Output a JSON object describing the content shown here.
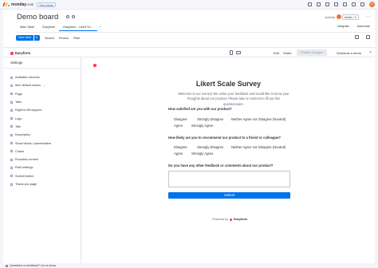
{
  "topbar": {
    "brand": "monday",
    "brand_suffix": ".com",
    "see_plans": "See plans",
    "avatar_initials": "ST",
    "colors": {
      "logo": [
        "#ff3d57",
        "#ffcb00",
        "#00ca72"
      ]
    }
  },
  "board": {
    "title": "Demo board",
    "activity": "Activity",
    "invite": "Invite / 1",
    "tabs": [
      "Main Table",
      "Easyform",
      "Easyform - Likert Sc..."
    ],
    "right_tabs": [
      "Integrate",
      "Automate"
    ],
    "actions": {
      "new_item": "New Item",
      "search": "Search",
      "person": "Person",
      "filter": "Filter"
    }
  },
  "builder": {
    "app_name": "Easyform",
    "edit": "Edit",
    "share": "Share",
    "publish": "Publish changes",
    "schedule_demo": "Schedule a demo",
    "close": "×"
  },
  "sidebar": {
    "heading": "Settings",
    "items": [
      "Available columns",
      "Item default values",
      "Page",
      "Tabs",
      "Right to left support",
      "Logo",
      "Title",
      "Description",
      "Show labels / placeholders",
      "Colors",
      "Rounded corners",
      "Field settings",
      "Submit button",
      "Thank you page"
    ],
    "feedback": "Questions or feedback? Let us know"
  },
  "form": {
    "title": "Likert Scale Survey",
    "intro": "Welcome to our survey! We value your feedback and would like to know your thoughts about our product. Please take a moment to fill out this questionnaire.",
    "questions": [
      {
        "label": "How satisfied are you with our product?",
        "options": [
          "Disagree",
          "Strongly Disagree",
          "Neither Agree nor Disagree (Neutral)",
          "Agree",
          "Strongly Agree"
        ]
      },
      {
        "label": "How likely are you to recommend our product to a friend or colleague?",
        "options": [
          "Disagree",
          "Strongly Disagree",
          "Neither Agree nor Disagree (Neutral)",
          "Agree",
          "Strongly Agree"
        ]
      },
      {
        "label": "Do you have any other feedback or comments about our product?"
      }
    ],
    "submit": "Submit",
    "powered_by": "Powered by",
    "powered_brand": "Easyform"
  }
}
